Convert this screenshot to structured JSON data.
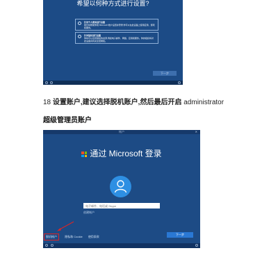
{
  "screenshot1": {
    "title": "希望以何种方式进行设置?",
    "option1": {
      "title": "针对个人使用进行设置",
      "desc": "我们将帮助你用 Microsoft 帐户设置并登录,你可以在此设备上使用应用、游戏和服务。"
    },
    "option2": {
      "title": "针对组织进行设置",
      "desc": "你将可以访问组织的资源,例如电子邮件、网络、应用和服务。你的组织将对此设备具有完全控制权。"
    },
    "next_label": "下一步"
  },
  "caption": {
    "number": "18",
    "bold_text": "设置账户,建议选择脱机账户,然后最后开启",
    "normal_text": "administrator"
  },
  "heading": "超级管理员账户",
  "screenshot2": {
    "topbar": "帐户",
    "signin_title": "通过 Microsoft 登录",
    "email_placeholder": "电子邮件、电话或 Skype",
    "forgot_link": "创建帐户",
    "links": {
      "offline": "脱机帐户",
      "privacy": "隐私和 Cookie",
      "terms": "使用条款"
    },
    "next_label": "下一步"
  },
  "colors": {
    "oobe_blue": "#1d4b85",
    "highlight_red": "#e02424",
    "button_blue": "#2a78d4"
  }
}
